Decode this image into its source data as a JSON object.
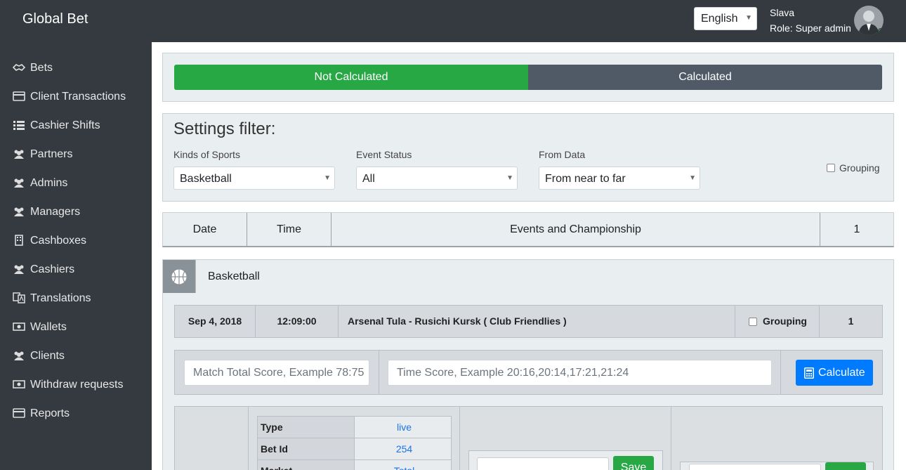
{
  "app": {
    "brand": "Global Bet"
  },
  "header": {
    "language": "English",
    "user_name": "Slava",
    "user_role": "Role: Super admin"
  },
  "sidebar": {
    "items": [
      {
        "label": "Bets",
        "icon": "handshake-icon"
      },
      {
        "label": "Client Transactions",
        "icon": "credit-card-icon"
      },
      {
        "label": "Cashier Shifts",
        "icon": "list-icon"
      },
      {
        "label": "Partners",
        "icon": "users-icon"
      },
      {
        "label": "Admins",
        "icon": "users-icon"
      },
      {
        "label": "Managers",
        "icon": "users-icon"
      },
      {
        "label": "Cashboxes",
        "icon": "building-icon"
      },
      {
        "label": "Cashiers",
        "icon": "users-icon"
      },
      {
        "label": "Translations",
        "icon": "language-icon"
      },
      {
        "label": "Wallets",
        "icon": "money-icon"
      },
      {
        "label": "Clients",
        "icon": "users-icon"
      },
      {
        "label": "Withdraw requests",
        "icon": "money-icon"
      },
      {
        "label": "Reports",
        "icon": "credit-card-icon"
      }
    ]
  },
  "tabs": {
    "not_calculated": "Not Calculated",
    "calculated": "Calculated"
  },
  "filter": {
    "title": "Settings filter:",
    "sports_label": "Kinds of Sports",
    "sports_value": "Basketball",
    "status_label": "Event Status",
    "status_value": "All",
    "data_label": "From Data",
    "data_value": "From near to far",
    "grouping_label": "Grouping"
  },
  "table_header": {
    "date": "Date",
    "time": "Time",
    "events": "Events and Championship",
    "count": "1"
  },
  "sport_section": {
    "name": "Basketball"
  },
  "event": {
    "date": "Sep 4, 2018",
    "time": "12:09:00",
    "title": "Arsenal Tula - Rusichi Kursk ( Club Friendlies )",
    "grouping_label": "Grouping",
    "count": "1"
  },
  "calc": {
    "total_placeholder": "Match Total Score, Example 78:75",
    "time_placeholder": "Time Score, Example 20:16,20:14,17:21,21:24",
    "button": "Calculate"
  },
  "detail": {
    "rows": [
      {
        "key": "Type",
        "value": "live"
      },
      {
        "key": "Bet Id",
        "value": "254"
      },
      {
        "key": "Market",
        "value": "Total"
      }
    ],
    "save_label": "Save"
  },
  "colors": {
    "topbar": "#343a40",
    "green": "#28a745",
    "blue": "#007bff",
    "tab_inactive": "#4f5a66"
  }
}
